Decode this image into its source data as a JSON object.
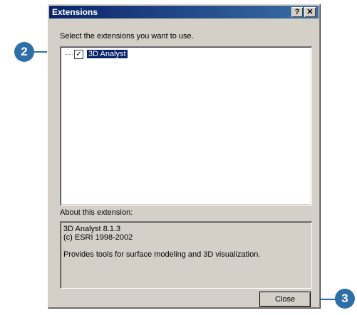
{
  "window": {
    "title": "Extensions"
  },
  "titlebar": {
    "help_glyph": "?",
    "close_glyph": "✕"
  },
  "main": {
    "instruction": "Select the extensions you want to use.",
    "extensions": [
      {
        "label": "3D Analyst",
        "checked": true,
        "check_glyph": "✓"
      }
    ],
    "about_label": "About this extension:",
    "about": {
      "line1": "3D Analyst 8.1.3",
      "line2": "(c) ESRI 1998-2002",
      "line3": "Provides tools for surface modeling and 3D visualization."
    }
  },
  "buttons": {
    "close_label": "Close"
  },
  "callouts": {
    "step2": "2",
    "step3": "3"
  },
  "colors": {
    "accent": "#2f6fa8",
    "titlebar": "#0a246a",
    "selection": "#0a246a"
  }
}
